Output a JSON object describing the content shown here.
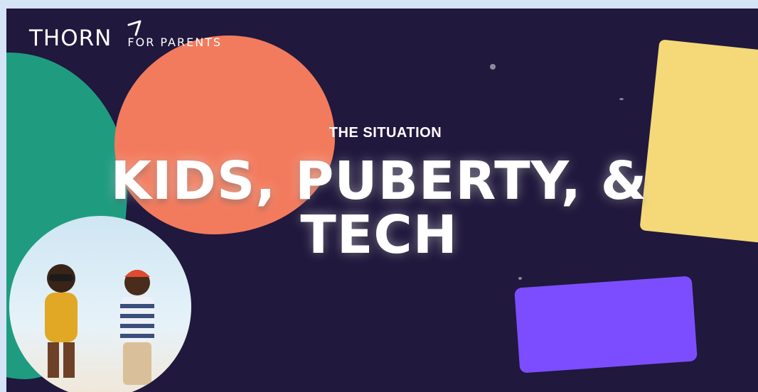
{
  "logo": {
    "brand": "THORN",
    "tagline": "FOR PARENTS",
    "mark_icon": "arrow-icon"
  },
  "hero": {
    "eyebrow": "THE SITUATION",
    "title_line1": "KIDS, PUBERTY, &",
    "title_line2": "TECH"
  },
  "colors": {
    "background": "#20183d",
    "teal": "#1f9c80",
    "coral": "#f37b5d",
    "yellow": "#f5d878",
    "purple": "#7c4dff",
    "text": "#ffffff"
  },
  "photo": {
    "icon": "children-photo"
  }
}
